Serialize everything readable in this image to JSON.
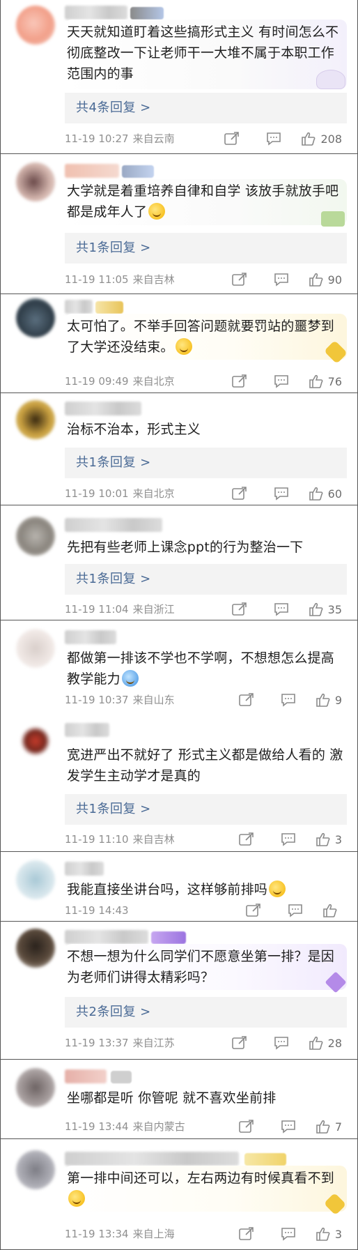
{
  "comments": [
    {
      "text": "天天就知道盯着这些搞形式主义   有时间怎么不彻底整改一下让老师干一大堆不属于本职工作范围内的事",
      "replies": "共4条回复 >",
      "date": "11-19 10:27",
      "location": "来自云南",
      "likes": "208"
    },
    {
      "text": "大学就是着重培养自律和自学 该放手就放手吧 都是成年人了",
      "replies": "共1条回复 >",
      "date": "11-19 11:05",
      "location": "来自吉林",
      "likes": "90"
    },
    {
      "text": "太可怕了。不举手回答问题就要罚站的噩梦到了大学还没结束。",
      "replies": "",
      "date": "11-19 09:49",
      "location": "来自北京",
      "likes": "76"
    },
    {
      "text": "治标不治本，形式主义",
      "replies": "共1条回复 >",
      "date": "11-19 10:01",
      "location": "来自北京",
      "likes": "60"
    },
    {
      "text": "先把有些老师上课念ppt的行为整治一下",
      "replies": "共1条回复 >",
      "date": "11-19 11:04",
      "location": "来自浙江",
      "likes": "35"
    },
    {
      "text": "都做第一排该不学也不学啊，不想想怎么提高教学能力",
      "replies": "",
      "date": "11-19 10:37",
      "location": "来自山东",
      "likes": "9"
    },
    {
      "text": "宽进严出不就好了 形式主义都是做给人看的 激发学生主动学才是真的",
      "replies": "共1条回复 >",
      "date": "11-19 11:10",
      "location": "来自吉林",
      "likes": "3"
    },
    {
      "text": "我能直接坐讲台吗，这样够前排吗",
      "replies": "",
      "date": "11-19 14:43",
      "location": "",
      "likes": ""
    },
    {
      "text": "不想一想为什么同学们不愿意坐第一排？是因为老师们讲得太精彩吗？",
      "replies": "共2条回复 >",
      "date": "11-19 13:37",
      "location": "来自江苏",
      "likes": "28"
    },
    {
      "text": "坐哪都是听 你管呢 就不喜欢坐前排",
      "replies": "",
      "date": "11-19 13:44",
      "location": "来自内蒙古",
      "likes": "7"
    },
    {
      "text": "第一排中间还可以，左右两边有时候真看不到",
      "replies": "",
      "date": "11-19 13:34",
      "location": "来自上海",
      "likes": "3"
    }
  ],
  "colors": {
    "reply_link": "#4a6a95",
    "meta_text": "#8f8f8f",
    "reply_box": "#f3f3f3"
  },
  "icons": {
    "share": "share-icon",
    "comment": "comment-icon",
    "like": "thumbs-up-icon"
  }
}
